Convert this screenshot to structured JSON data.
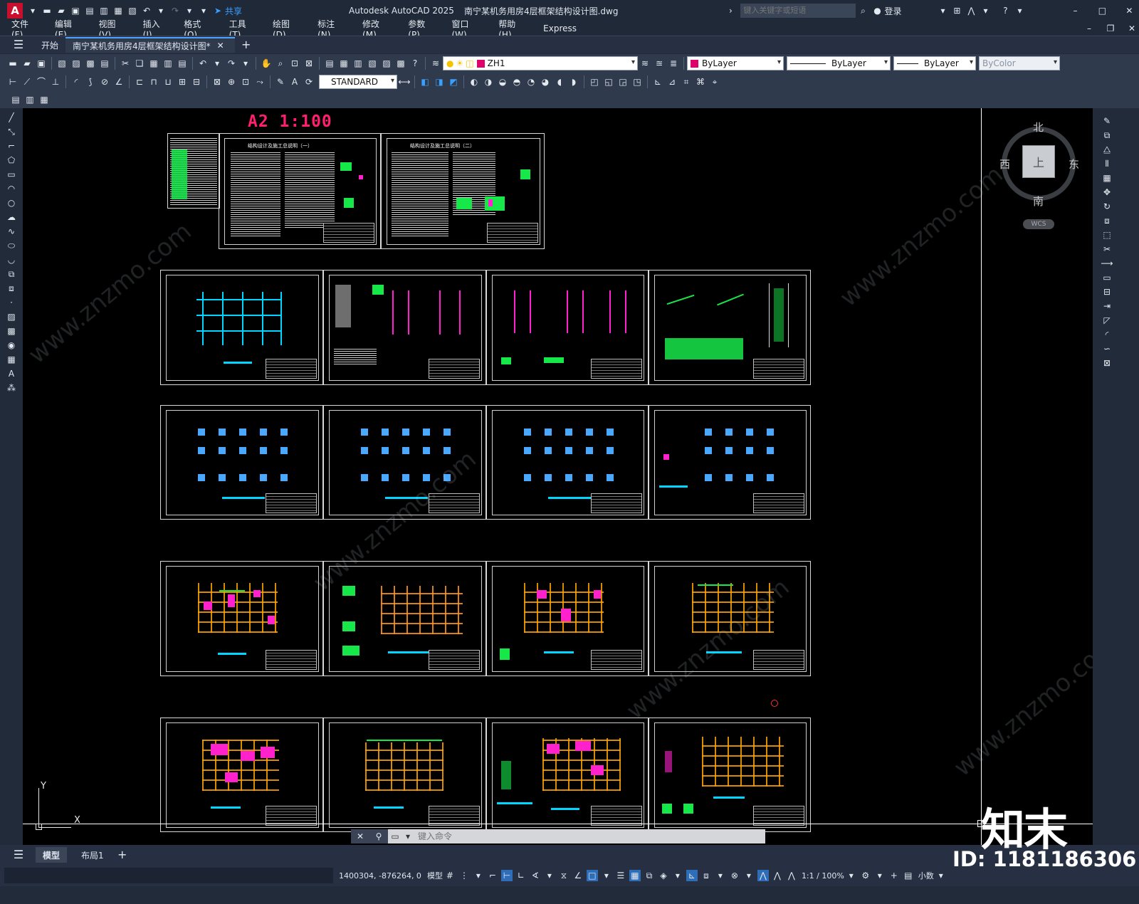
{
  "app": {
    "name": "Autodesk AutoCAD 2025",
    "file": "南宁某机务用房4层框架结构设计图.dwg",
    "share": "共享",
    "search_placeholder": "键入关键字或短语",
    "login": "登录"
  },
  "menu": [
    "文件(F)",
    "编辑(E)",
    "视图(V)",
    "插入(I)",
    "格式(O)",
    "工具(T)",
    "绘图(D)",
    "标注(N)",
    "修改(M)",
    "参数(P)",
    "窗口(W)",
    "帮助(H)",
    "Express"
  ],
  "tabs": {
    "start": "开始",
    "doc": "南宁某机务用房4层框架结构设计图*",
    "add": "+"
  },
  "toolbar": {
    "layer": "ZH1",
    "color": "ByLayer",
    "linetype": "ByLayer",
    "lineweight": "ByLayer",
    "plotstyle": "ByColor",
    "textstyle": "STANDARD"
  },
  "drawing": {
    "scale_label": "A2  1:100",
    "sheet1_title": "结构设计及施工总说明（一）",
    "sheet2_title": "结构设计及施工总说明（二）"
  },
  "viewcube": {
    "north": "北",
    "south": "南",
    "east": "东",
    "west": "西",
    "top": "上",
    "wcs": "WCS"
  },
  "ucs": {
    "x": "X",
    "y": "Y"
  },
  "layout_tabs": [
    "模型",
    "布局1"
  ],
  "status": {
    "coords": "1400304, -876264, 0",
    "space": "模型",
    "scale": "1:1 / 100%",
    "units": "小数"
  },
  "cmdline": {
    "placeholder": "键入命令"
  },
  "watermarks": {
    "brand": "知末",
    "id": "ID: 1181186306",
    "site": "www.znzmo.com"
  }
}
